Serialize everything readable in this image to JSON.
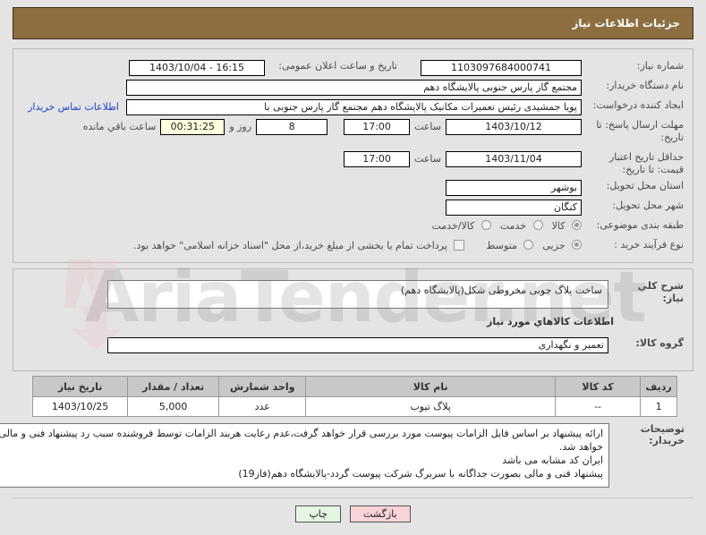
{
  "header": {
    "title": "جزئیات اطلاعات نیاز"
  },
  "form": {
    "need_number": {
      "label": "شماره نیاز:",
      "value": "1103097684000741"
    },
    "announce_date": {
      "label": "تاریخ و ساعت اعلان عمومی:",
      "value": "16:15 - 1403/10/04"
    },
    "buyer_org": {
      "label": "نام دستگاه خریدار:",
      "value": "مجتمع گاز پارس جنوبی  پالایشگاه دهم"
    },
    "creator": {
      "label": "ایجاد کننده درخواست:",
      "value": "پویا جمشیدی رئیس تعمیرات مکانیک پالایشگاه دهم  مجتمع گاز پارس جنوبی  با",
      "link": "اطلاعات تماس خریدار"
    },
    "response_deadline": {
      "label": "مهلت ارسال پاسخ: تا تاریخ:",
      "date": "1403/10/12",
      "time_unit": "ساعت",
      "time": "17:00",
      "days": "8",
      "days_unit": "روز و",
      "countdown": "00:31:25",
      "countdown_unit": "ساعت باقي مانده"
    },
    "price_validity": {
      "label": "حداقل تاریخ اعتبار قیمت: تا تاریخ:",
      "date": "1403/11/04",
      "time_unit": "ساعت",
      "time": "17:00"
    },
    "delivery_province": {
      "label": "استان محل تحویل:",
      "value": "بوشهر"
    },
    "delivery_city": {
      "label": "شهر محل تحویل:",
      "value": "کنگان"
    },
    "category": {
      "label": "طبقه بندی موضوعی:",
      "options": [
        {
          "label": "کالا",
          "selected": true
        },
        {
          "label": "خدمت",
          "selected": false
        },
        {
          "label": "کالا/خدمت",
          "selected": false
        }
      ]
    },
    "process_type": {
      "label": "نوع فرآیند خرید :",
      "options": [
        {
          "label": "جزیی",
          "selected": true
        },
        {
          "label": "متوسط",
          "selected": false
        }
      ],
      "checkbox_label": "پرداخت تمام یا بخشی از مبلغ خرید،از محل \"اسناد خزانه اسلامی\" خواهد بود.",
      "checkbox_checked": false
    }
  },
  "description": {
    "label": "شرح کلي نیاز:",
    "value": "ساخت پلاگ چوبی مخروطی شکل(پالایشگاه دهم)"
  },
  "goods_section": {
    "title": "اطلاعات کالاهاي مورد نیاز",
    "group_label": "گروه کالا:",
    "group_value": "تعمیر و نگهداری"
  },
  "items_table": {
    "columns": [
      "ردیف",
      "کد کالا",
      "نام کالا",
      "واحد شمارش",
      "تعداد / مقدار",
      "تاریخ نیاز"
    ],
    "rows": [
      {
        "row": "1",
        "code": "--",
        "name": "پلاگ تیوب",
        "unit": "عدد",
        "qty": "5,000",
        "need_date": "1403/10/25"
      }
    ]
  },
  "buyer_notes": {
    "label": "توضیحات خریدار:",
    "value": "ارائه پیشنهاد بر اساس فایل الزامات پیوست مورد بررسی قرار خواهد گرفت،عدم رعایت هربند الزامات توسط فروشنده سبب رد پیشنهاد فنی و مالی خواهد شد.\nایران کد مشابه می باشد\nپیشنهاد فنی و مالی بصورت جداگانه با سربرگ شرکت پیوست گردد-پالایشگاه دهم(فاز19)"
  },
  "buttons": {
    "print": "چاپ",
    "back": "بازگشت"
  },
  "watermark": {
    "text": "AriaTender.net"
  },
  "colors": {
    "header_bg": "#8d6e41",
    "link": "#1c43c8",
    "countdown_bg": "#ffffe0",
    "print_bg": "#e4f6e2",
    "back_bg": "#f8d3d7",
    "page_bg": "#e4e4e4"
  }
}
